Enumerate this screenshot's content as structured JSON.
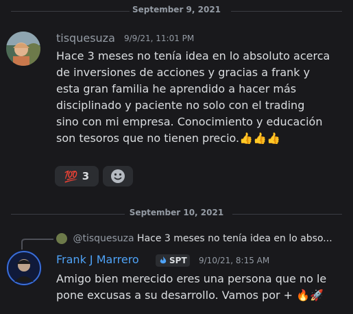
{
  "dividers": {
    "first": "September 9, 2021",
    "second": "September 10, 2021"
  },
  "message1": {
    "username": "tisquesuza",
    "timestamp": "9/9/21, 11:01 PM",
    "lines": [
      "Hace 3 meses no tenía idea en lo absoluto acerca",
      "de inversiones de acciones y gracias a frank y",
      "esta gran familia he aprendido a hacer más",
      "disciplinado y paciente no solo con el trading",
      "sino con mi empresa. Conocimiento y educación",
      "son tesoros que no tienen precio."
    ],
    "emoji_suffix": "👍👍👍",
    "reactions": {
      "hundred": {
        "emoji": "💯",
        "count": "3"
      }
    }
  },
  "message2": {
    "reply": {
      "mention": "@tisquesuza",
      "preview": "Hace 3 meses no tenía idea en lo abso..."
    },
    "username": "Frank J Marrero",
    "badge": "SPT",
    "timestamp": "9/10/21, 8:15 AM",
    "lines": [
      "Amigo bien merecido eres una persona que no le",
      "pone excusas a su desarrollo. Vamos por +"
    ],
    "emoji_suffix": "🔥🚀"
  },
  "colors": {
    "background": "#19191c",
    "username_default": "#949ba4",
    "username_frank": "#4fa3f7",
    "timestamp": "#949ba4",
    "text": "#dbdee1"
  }
}
